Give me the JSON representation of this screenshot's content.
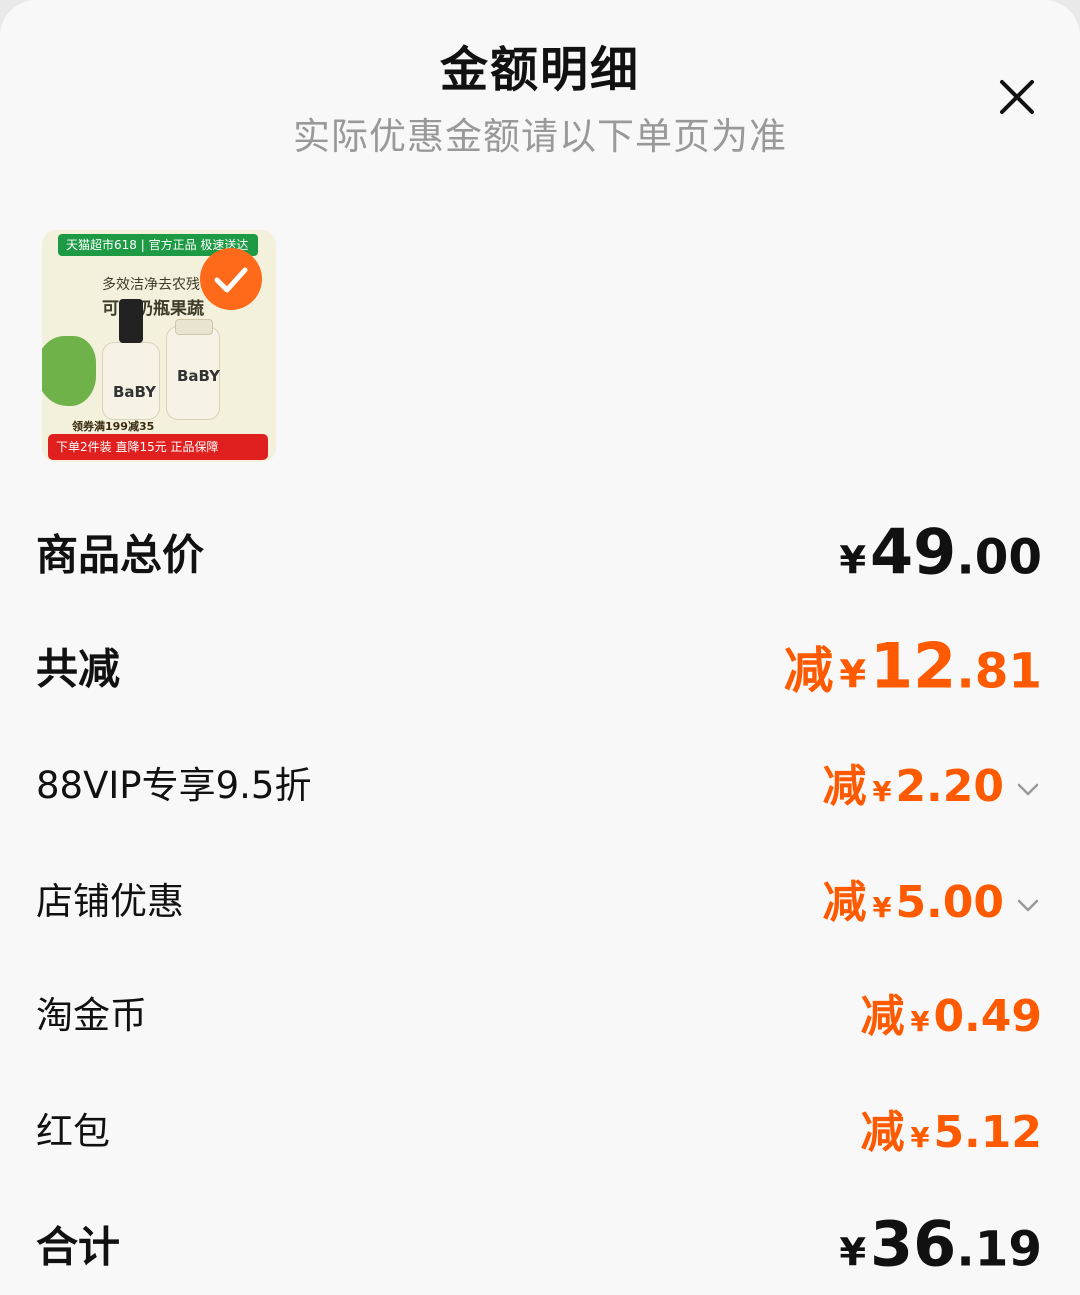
{
  "header": {
    "title": "金额明细",
    "subtitle": "实际优惠金额请以下单页为准"
  },
  "product": {
    "image_text": {
      "banner": "天猫超市618 | 官方正品 极速送达",
      "headline_1": "多效洁净去农残",
      "headline_2": "可洗奶瓶果蔬",
      "bottle_label": "BaBY",
      "coupon": "领券满199减35",
      "footer": "下单2件装 直降15元 正品保障"
    },
    "selected": true
  },
  "summary": {
    "total_price": {
      "label": "商品总价",
      "currency": "¥",
      "integer": "49",
      "decimal": ".00"
    },
    "total_discount": {
      "label": "共减",
      "prefix": "减",
      "currency": "¥",
      "integer": "12",
      "decimal": ".81"
    },
    "items": [
      {
        "label": "88VIP专享9.5折",
        "prefix": "减",
        "currency": "¥",
        "amount": "2.20",
        "expandable": true
      },
      {
        "label": "店铺优惠",
        "prefix": "减",
        "currency": "¥",
        "amount": "5.00",
        "expandable": true
      },
      {
        "label": "淘金币",
        "prefix": "减",
        "currency": "¥",
        "amount": "0.49",
        "expandable": false
      },
      {
        "label": "红包",
        "prefix": "减",
        "currency": "¥",
        "amount": "5.12",
        "expandable": false
      }
    ],
    "grand_total": {
      "label": "合计",
      "currency": "¥",
      "integer": "36",
      "decimal": ".19"
    }
  },
  "colors": {
    "accent": "#ff5a00",
    "text": "#111111",
    "subtle": "#999999",
    "check_badge": "#ff6a1a"
  },
  "icons": {
    "close": "close-icon",
    "check": "check-icon",
    "expand": "chevron-down-icon"
  }
}
